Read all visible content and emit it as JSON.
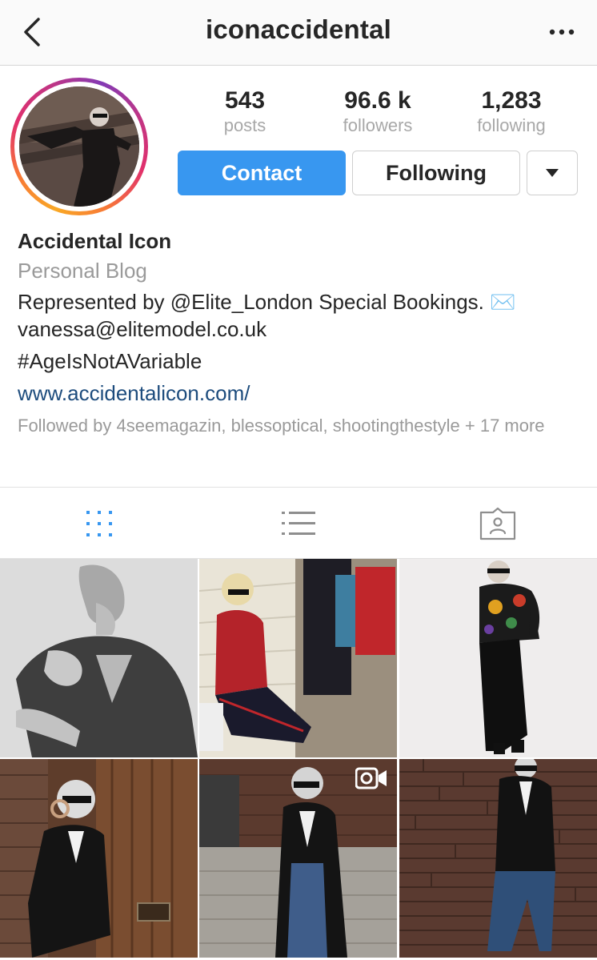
{
  "header": {
    "username": "iconaccidental",
    "back_icon": "chevron-left-icon",
    "more_icon": "more-horizontal-icon"
  },
  "profile": {
    "stats": [
      {
        "value": "543",
        "label": "posts"
      },
      {
        "value": "96.6 k",
        "label": "followers"
      },
      {
        "value": "1,283",
        "label": "following"
      }
    ],
    "contact_label": "Contact",
    "following_label": "Following",
    "dropdown_icon": "triangle-down-icon"
  },
  "bio": {
    "name": "Accidental Icon",
    "category": "Personal Blog",
    "line1": "Represented by @Elite_London Special Bookings. ✉️",
    "line2": "vanessa@elitemodel.co.uk",
    "hashtag": "#AgeIsNotAVariable",
    "website": "www.accidentalicon.com/",
    "followed_by": "Followed by 4seemagazin, blessoptical, shootingthestyle + 17 more"
  },
  "tabs": [
    {
      "icon": "grid-icon",
      "active": true
    },
    {
      "icon": "list-icon",
      "active": false
    },
    {
      "icon": "tagged-icon",
      "active": false
    }
  ],
  "colors": {
    "accent": "#3897f0",
    "link": "#1d4c7d",
    "muted": "#9a9a9a"
  },
  "grid": [
    {
      "kind": "photo",
      "video": false
    },
    {
      "kind": "photo",
      "video": false
    },
    {
      "kind": "photo",
      "video": false
    },
    {
      "kind": "photo",
      "video": false
    },
    {
      "kind": "photo",
      "video": true
    },
    {
      "kind": "photo",
      "video": false
    }
  ]
}
